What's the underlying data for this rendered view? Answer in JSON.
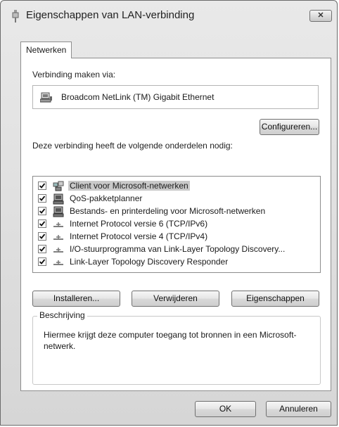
{
  "window": {
    "title": "Eigenschappen van LAN-verbinding",
    "close_label": "✕"
  },
  "tabs": [
    {
      "label": "Netwerken"
    }
  ],
  "connect_via": {
    "label": "Verbinding maken via:",
    "adapter": "Broadcom NetLink (TM) Gigabit Ethernet"
  },
  "configure_button": "Configureren...",
  "components": {
    "label": "Deze verbinding heeft de volgende onderdelen nodig:",
    "items": [
      {
        "label": "Client voor Microsoft-netwerken",
        "checked": true,
        "icon": "network-client-icon"
      },
      {
        "label": "QoS-pakketplanner",
        "checked": true,
        "icon": "computer-service-icon"
      },
      {
        "label": "Bestands- en printerdeling voor Microsoft-netwerken",
        "checked": true,
        "icon": "computer-service-icon"
      },
      {
        "label": "Internet Protocol versie 6 (TCP/IPv6)",
        "checked": true,
        "icon": "protocol-icon"
      },
      {
        "label": "Internet Protocol versie 4 (TCP/IPv4)",
        "checked": true,
        "icon": "protocol-icon"
      },
      {
        "label": "I/O-stuurprogramma van Link-Layer Topology Discovery...",
        "checked": true,
        "icon": "protocol-icon"
      },
      {
        "label": "Link-Layer Topology Discovery Responder",
        "checked": true,
        "icon": "protocol-icon"
      }
    ]
  },
  "actions": {
    "install": "Installeren...",
    "uninstall": "Verwijderen",
    "properties": "Eigenschappen"
  },
  "description": {
    "legend": "Beschrijving",
    "text": "Hiermee krijgt deze computer toegang tot bronnen in een Microsoft-netwerk."
  },
  "footer": {
    "ok": "OK",
    "cancel": "Annuleren"
  }
}
